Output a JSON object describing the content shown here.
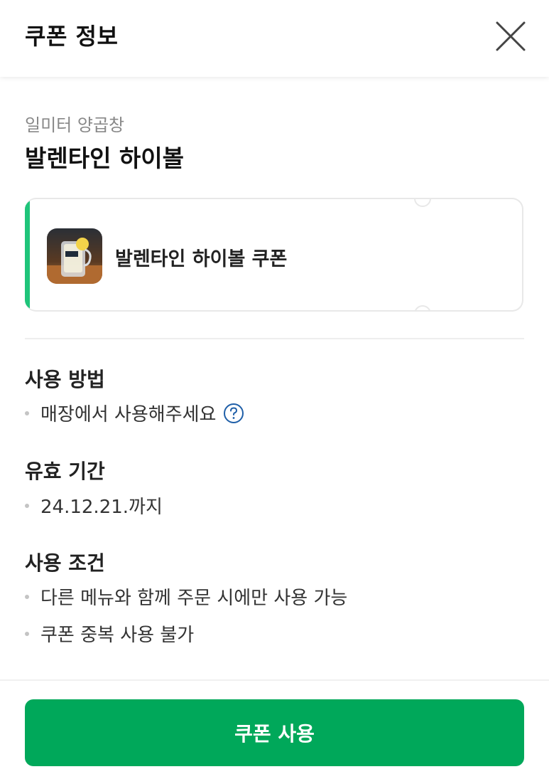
{
  "header": {
    "title": "쿠폰 정보",
    "close_icon": "close-icon"
  },
  "store": {
    "name": "일미터 양곱창"
  },
  "product": {
    "title": "발렌타인 하이볼"
  },
  "coupon": {
    "name": "발렌타인 하이볼 쿠폰",
    "accent_color": "#1fc47a"
  },
  "usage_method": {
    "title": "사용 방법",
    "items": [
      "매장에서 사용해주세요"
    ],
    "help_icon": "question-circle-icon"
  },
  "validity": {
    "title": "유효 기간",
    "items": [
      "24.12.21.까지"
    ]
  },
  "conditions": {
    "title": "사용 조건",
    "items": [
      "다른 메뉴와 함께 주문 시에만 사용 가능",
      "쿠폰 중복 사용 불가"
    ]
  },
  "action": {
    "button_label": "쿠폰 사용",
    "button_color": "#00a85a"
  }
}
